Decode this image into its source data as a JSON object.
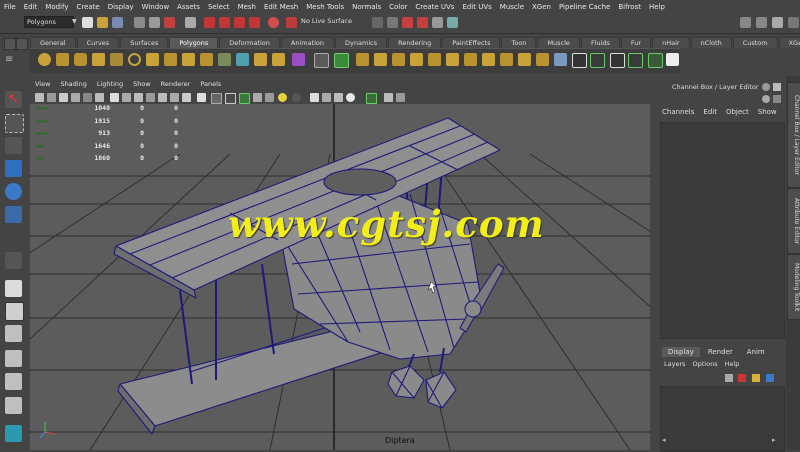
{
  "menu_bar": [
    "File",
    "Edit",
    "Modify",
    "Create",
    "Display",
    "Window",
    "Assets",
    "Select",
    "Mesh",
    "Edit Mesh",
    "Mesh Tools",
    "Normals",
    "Color",
    "Create UVs",
    "Edit UVs",
    "Muscle",
    "XGen",
    "Pipeline Cache",
    "Bifrost",
    "Help"
  ],
  "status_line": {
    "mode": "Polygons",
    "live_surface": "No Live Surface"
  },
  "shelf": {
    "tabs": [
      "General",
      "Curves",
      "Surfaces",
      "Polygons",
      "Deformation",
      "Animation",
      "Dynamics",
      "Rendering",
      "PaintEffects",
      "Toon",
      "Muscle",
      "Fluids",
      "Fur",
      "nHair",
      "nCloth",
      "Custom",
      "XGen"
    ],
    "active_tab": "Polygons"
  },
  "panel": {
    "menus": [
      "View",
      "Shading",
      "Lighting",
      "Show",
      "Renderer",
      "Panels"
    ],
    "camera_name": "Diptera"
  },
  "hud": [
    {
      "values": [
        "1040",
        "0",
        "0"
      ]
    },
    {
      "values": [
        "1915",
        "0",
        "0"
      ]
    },
    {
      "values": [
        "913",
        "0",
        "0"
      ]
    },
    {
      "values": [
        "1646",
        "0",
        "0"
      ]
    },
    {
      "values": [
        "1860",
        "0",
        "0"
      ]
    }
  ],
  "watermark": "www.cgtsj.com",
  "channel_box": {
    "title": "Channel Box / Layer Editor",
    "menus": [
      "Channels",
      "Edit",
      "Object",
      "Show"
    ]
  },
  "layer_editor": {
    "tabs": [
      "Display",
      "Render",
      "Anim"
    ],
    "active_tab": "Display",
    "menus": [
      "Layers",
      "Options",
      "Help"
    ]
  },
  "side_tabs": [
    "Channel Box / Layer Editor",
    "Attribute Editor",
    "Modeling Toolkit"
  ],
  "colors": {
    "viewport_bg": "#5c5c5c",
    "grid": "#2e2e2e",
    "mesh": "#7a7a7a",
    "wire": "#1e1a7a",
    "watermark": "#f2ee18"
  }
}
